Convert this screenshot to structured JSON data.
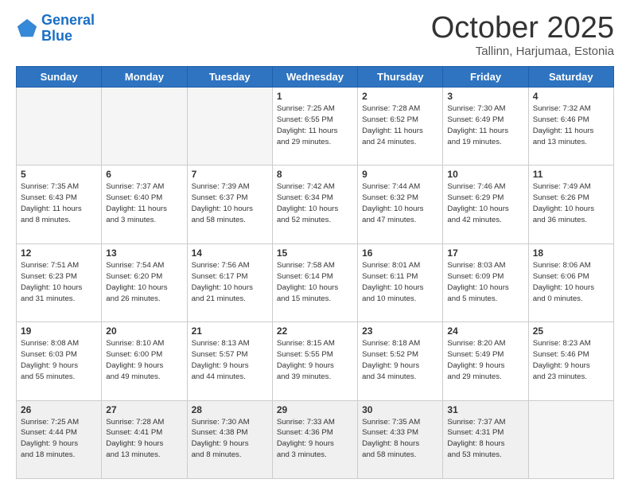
{
  "logo": {
    "line1": "General",
    "line2": "Blue"
  },
  "header": {
    "month": "October 2025",
    "location": "Tallinn, Harjumaa, Estonia"
  },
  "days_of_week": [
    "Sunday",
    "Monday",
    "Tuesday",
    "Wednesday",
    "Thursday",
    "Friday",
    "Saturday"
  ],
  "weeks": [
    [
      {
        "day": "",
        "empty": true
      },
      {
        "day": "",
        "empty": true
      },
      {
        "day": "",
        "empty": true
      },
      {
        "day": "1",
        "info": "Sunrise: 7:25 AM\nSunset: 6:55 PM\nDaylight: 11 hours\nand 29 minutes."
      },
      {
        "day": "2",
        "info": "Sunrise: 7:28 AM\nSunset: 6:52 PM\nDaylight: 11 hours\nand 24 minutes."
      },
      {
        "day": "3",
        "info": "Sunrise: 7:30 AM\nSunset: 6:49 PM\nDaylight: 11 hours\nand 19 minutes."
      },
      {
        "day": "4",
        "info": "Sunrise: 7:32 AM\nSunset: 6:46 PM\nDaylight: 11 hours\nand 13 minutes."
      }
    ],
    [
      {
        "day": "5",
        "info": "Sunrise: 7:35 AM\nSunset: 6:43 PM\nDaylight: 11 hours\nand 8 minutes."
      },
      {
        "day": "6",
        "info": "Sunrise: 7:37 AM\nSunset: 6:40 PM\nDaylight: 11 hours\nand 3 minutes."
      },
      {
        "day": "7",
        "info": "Sunrise: 7:39 AM\nSunset: 6:37 PM\nDaylight: 10 hours\nand 58 minutes."
      },
      {
        "day": "8",
        "info": "Sunrise: 7:42 AM\nSunset: 6:34 PM\nDaylight: 10 hours\nand 52 minutes."
      },
      {
        "day": "9",
        "info": "Sunrise: 7:44 AM\nSunset: 6:32 PM\nDaylight: 10 hours\nand 47 minutes."
      },
      {
        "day": "10",
        "info": "Sunrise: 7:46 AM\nSunset: 6:29 PM\nDaylight: 10 hours\nand 42 minutes."
      },
      {
        "day": "11",
        "info": "Sunrise: 7:49 AM\nSunset: 6:26 PM\nDaylight: 10 hours\nand 36 minutes."
      }
    ],
    [
      {
        "day": "12",
        "info": "Sunrise: 7:51 AM\nSunset: 6:23 PM\nDaylight: 10 hours\nand 31 minutes."
      },
      {
        "day": "13",
        "info": "Sunrise: 7:54 AM\nSunset: 6:20 PM\nDaylight: 10 hours\nand 26 minutes."
      },
      {
        "day": "14",
        "info": "Sunrise: 7:56 AM\nSunset: 6:17 PM\nDaylight: 10 hours\nand 21 minutes."
      },
      {
        "day": "15",
        "info": "Sunrise: 7:58 AM\nSunset: 6:14 PM\nDaylight: 10 hours\nand 15 minutes."
      },
      {
        "day": "16",
        "info": "Sunrise: 8:01 AM\nSunset: 6:11 PM\nDaylight: 10 hours\nand 10 minutes."
      },
      {
        "day": "17",
        "info": "Sunrise: 8:03 AM\nSunset: 6:09 PM\nDaylight: 10 hours\nand 5 minutes."
      },
      {
        "day": "18",
        "info": "Sunrise: 8:06 AM\nSunset: 6:06 PM\nDaylight: 10 hours\nand 0 minutes."
      }
    ],
    [
      {
        "day": "19",
        "info": "Sunrise: 8:08 AM\nSunset: 6:03 PM\nDaylight: 9 hours\nand 55 minutes."
      },
      {
        "day": "20",
        "info": "Sunrise: 8:10 AM\nSunset: 6:00 PM\nDaylight: 9 hours\nand 49 minutes."
      },
      {
        "day": "21",
        "info": "Sunrise: 8:13 AM\nSunset: 5:57 PM\nDaylight: 9 hours\nand 44 minutes."
      },
      {
        "day": "22",
        "info": "Sunrise: 8:15 AM\nSunset: 5:55 PM\nDaylight: 9 hours\nand 39 minutes."
      },
      {
        "day": "23",
        "info": "Sunrise: 8:18 AM\nSunset: 5:52 PM\nDaylight: 9 hours\nand 34 minutes."
      },
      {
        "day": "24",
        "info": "Sunrise: 8:20 AM\nSunset: 5:49 PM\nDaylight: 9 hours\nand 29 minutes."
      },
      {
        "day": "25",
        "info": "Sunrise: 8:23 AM\nSunset: 5:46 PM\nDaylight: 9 hours\nand 23 minutes."
      }
    ],
    [
      {
        "day": "26",
        "info": "Sunrise: 7:25 AM\nSunset: 4:44 PM\nDaylight: 9 hours\nand 18 minutes."
      },
      {
        "day": "27",
        "info": "Sunrise: 7:28 AM\nSunset: 4:41 PM\nDaylight: 9 hours\nand 13 minutes."
      },
      {
        "day": "28",
        "info": "Sunrise: 7:30 AM\nSunset: 4:38 PM\nDaylight: 9 hours\nand 8 minutes."
      },
      {
        "day": "29",
        "info": "Sunrise: 7:33 AM\nSunset: 4:36 PM\nDaylight: 9 hours\nand 3 minutes."
      },
      {
        "day": "30",
        "info": "Sunrise: 7:35 AM\nSunset: 4:33 PM\nDaylight: 8 hours\nand 58 minutes."
      },
      {
        "day": "31",
        "info": "Sunrise: 7:37 AM\nSunset: 4:31 PM\nDaylight: 8 hours\nand 53 minutes."
      },
      {
        "day": "",
        "empty": true
      }
    ]
  ]
}
